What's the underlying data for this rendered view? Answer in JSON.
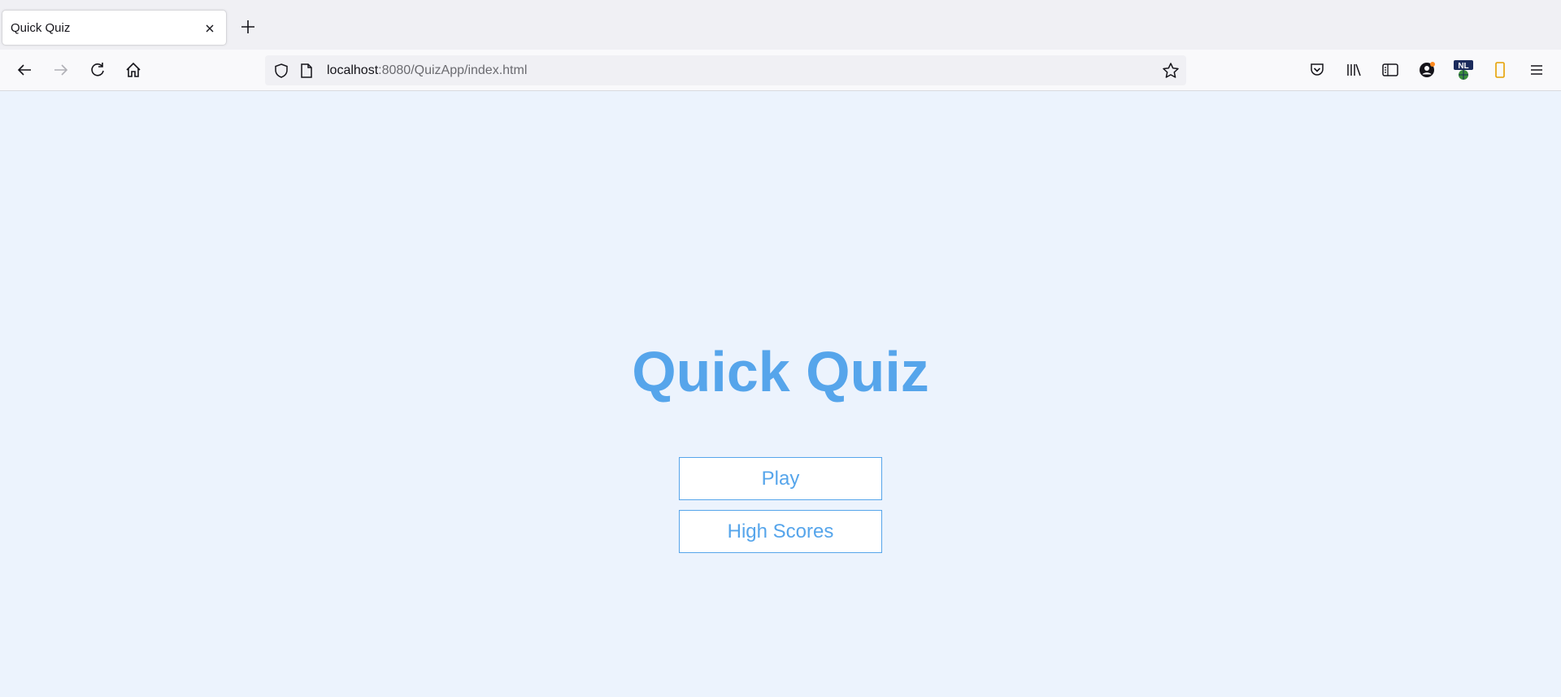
{
  "tab": {
    "title": "Quick Quiz"
  },
  "urlbar": {
    "host": "localhost",
    "rest": ":8080/QuizApp/index.html"
  },
  "toolbar": {
    "profile_badge": "NL"
  },
  "page": {
    "title": "Quick Quiz",
    "play_label": "Play",
    "high_scores_label": "High Scores"
  },
  "colors": {
    "accent": "#56a5eb",
    "background": "#ecf3fd"
  }
}
